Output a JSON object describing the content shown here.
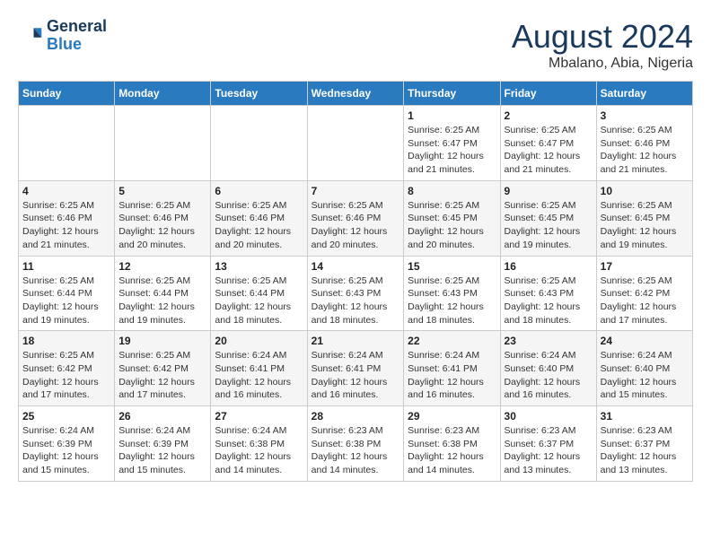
{
  "logo": {
    "line1": "General",
    "line2": "Blue"
  },
  "title": "August 2024",
  "location": "Mbalano, Abia, Nigeria",
  "days_of_week": [
    "Sunday",
    "Monday",
    "Tuesday",
    "Wednesday",
    "Thursday",
    "Friday",
    "Saturday"
  ],
  "weeks": [
    [
      {
        "day": "",
        "info": ""
      },
      {
        "day": "",
        "info": ""
      },
      {
        "day": "",
        "info": ""
      },
      {
        "day": "",
        "info": ""
      },
      {
        "day": "1",
        "info": "Sunrise: 6:25 AM\nSunset: 6:47 PM\nDaylight: 12 hours\nand 21 minutes."
      },
      {
        "day": "2",
        "info": "Sunrise: 6:25 AM\nSunset: 6:47 PM\nDaylight: 12 hours\nand 21 minutes."
      },
      {
        "day": "3",
        "info": "Sunrise: 6:25 AM\nSunset: 6:46 PM\nDaylight: 12 hours\nand 21 minutes."
      }
    ],
    [
      {
        "day": "4",
        "info": "Sunrise: 6:25 AM\nSunset: 6:46 PM\nDaylight: 12 hours\nand 21 minutes."
      },
      {
        "day": "5",
        "info": "Sunrise: 6:25 AM\nSunset: 6:46 PM\nDaylight: 12 hours\nand 20 minutes."
      },
      {
        "day": "6",
        "info": "Sunrise: 6:25 AM\nSunset: 6:46 PM\nDaylight: 12 hours\nand 20 minutes."
      },
      {
        "day": "7",
        "info": "Sunrise: 6:25 AM\nSunset: 6:46 PM\nDaylight: 12 hours\nand 20 minutes."
      },
      {
        "day": "8",
        "info": "Sunrise: 6:25 AM\nSunset: 6:45 PM\nDaylight: 12 hours\nand 20 minutes."
      },
      {
        "day": "9",
        "info": "Sunrise: 6:25 AM\nSunset: 6:45 PM\nDaylight: 12 hours\nand 19 minutes."
      },
      {
        "day": "10",
        "info": "Sunrise: 6:25 AM\nSunset: 6:45 PM\nDaylight: 12 hours\nand 19 minutes."
      }
    ],
    [
      {
        "day": "11",
        "info": "Sunrise: 6:25 AM\nSunset: 6:44 PM\nDaylight: 12 hours\nand 19 minutes."
      },
      {
        "day": "12",
        "info": "Sunrise: 6:25 AM\nSunset: 6:44 PM\nDaylight: 12 hours\nand 19 minutes."
      },
      {
        "day": "13",
        "info": "Sunrise: 6:25 AM\nSunset: 6:44 PM\nDaylight: 12 hours\nand 18 minutes."
      },
      {
        "day": "14",
        "info": "Sunrise: 6:25 AM\nSunset: 6:43 PM\nDaylight: 12 hours\nand 18 minutes."
      },
      {
        "day": "15",
        "info": "Sunrise: 6:25 AM\nSunset: 6:43 PM\nDaylight: 12 hours\nand 18 minutes."
      },
      {
        "day": "16",
        "info": "Sunrise: 6:25 AM\nSunset: 6:43 PM\nDaylight: 12 hours\nand 18 minutes."
      },
      {
        "day": "17",
        "info": "Sunrise: 6:25 AM\nSunset: 6:42 PM\nDaylight: 12 hours\nand 17 minutes."
      }
    ],
    [
      {
        "day": "18",
        "info": "Sunrise: 6:25 AM\nSunset: 6:42 PM\nDaylight: 12 hours\nand 17 minutes."
      },
      {
        "day": "19",
        "info": "Sunrise: 6:25 AM\nSunset: 6:42 PM\nDaylight: 12 hours\nand 17 minutes."
      },
      {
        "day": "20",
        "info": "Sunrise: 6:24 AM\nSunset: 6:41 PM\nDaylight: 12 hours\nand 16 minutes."
      },
      {
        "day": "21",
        "info": "Sunrise: 6:24 AM\nSunset: 6:41 PM\nDaylight: 12 hours\nand 16 minutes."
      },
      {
        "day": "22",
        "info": "Sunrise: 6:24 AM\nSunset: 6:41 PM\nDaylight: 12 hours\nand 16 minutes."
      },
      {
        "day": "23",
        "info": "Sunrise: 6:24 AM\nSunset: 6:40 PM\nDaylight: 12 hours\nand 16 minutes."
      },
      {
        "day": "24",
        "info": "Sunrise: 6:24 AM\nSunset: 6:40 PM\nDaylight: 12 hours\nand 15 minutes."
      }
    ],
    [
      {
        "day": "25",
        "info": "Sunrise: 6:24 AM\nSunset: 6:39 PM\nDaylight: 12 hours\nand 15 minutes."
      },
      {
        "day": "26",
        "info": "Sunrise: 6:24 AM\nSunset: 6:39 PM\nDaylight: 12 hours\nand 15 minutes."
      },
      {
        "day": "27",
        "info": "Sunrise: 6:24 AM\nSunset: 6:38 PM\nDaylight: 12 hours\nand 14 minutes."
      },
      {
        "day": "28",
        "info": "Sunrise: 6:23 AM\nSunset: 6:38 PM\nDaylight: 12 hours\nand 14 minutes."
      },
      {
        "day": "29",
        "info": "Sunrise: 6:23 AM\nSunset: 6:38 PM\nDaylight: 12 hours\nand 14 minutes."
      },
      {
        "day": "30",
        "info": "Sunrise: 6:23 AM\nSunset: 6:37 PM\nDaylight: 12 hours\nand 13 minutes."
      },
      {
        "day": "31",
        "info": "Sunrise: 6:23 AM\nSunset: 6:37 PM\nDaylight: 12 hours\nand 13 minutes."
      }
    ]
  ]
}
